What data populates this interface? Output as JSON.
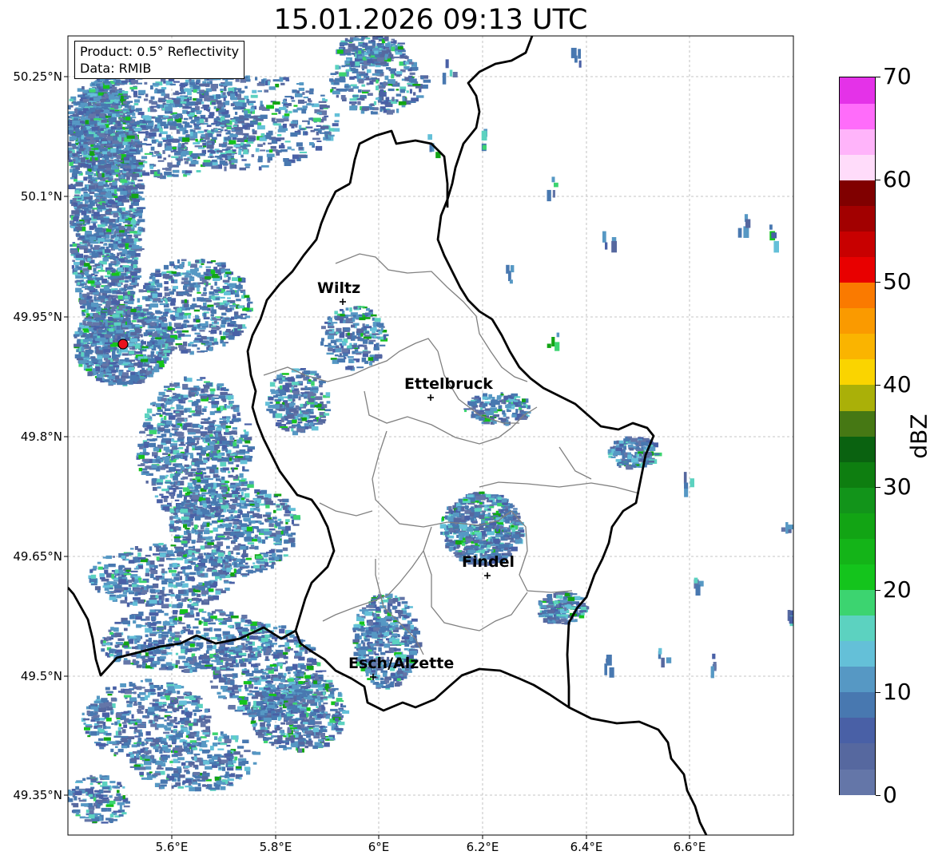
{
  "title": "15.01.2026 09:13 UTC",
  "info": {
    "product": "Product: 0.5° Reflectivity",
    "data": "Data: RMIB"
  },
  "lat_labels": [
    "50.25°N",
    "50.1°N",
    "49.95°N",
    "49.8°N",
    "49.65°N",
    "49.5°N",
    "49.35°N"
  ],
  "lon_labels": [
    "5.6°E",
    "5.8°E",
    "6°E",
    "6.2°E",
    "6.4°E",
    "6.6°E"
  ],
  "cities": [
    {
      "name": "Wiltz"
    },
    {
      "name": "Ettelbruck"
    },
    {
      "name": "Findel"
    },
    {
      "name": "Esch/Alzette"
    }
  ],
  "radar_site_color": "#e8121e",
  "colorbar": {
    "label": "dBZ",
    "ticks": [
      "0",
      "10",
      "20",
      "30",
      "40",
      "50",
      "60",
      "70"
    ],
    "colors": [
      "#6476a8",
      "#56689f",
      "#4960a6",
      "#4878b0",
      "#5698c4",
      "#64c0d8",
      "#5cd2c0",
      "#3cd470",
      "#14c41c",
      "#14b418",
      "#12a414",
      "#12941a",
      "#0e7e10",
      "#0a6210",
      "#467814",
      "#aab008",
      "#fad400",
      "#fab400",
      "#fa9a00",
      "#fa7a00",
      "#e80000",
      "#c80000",
      "#a20000",
      "#800000",
      "#ffdcfa",
      "#ffb4fa",
      "#ff6cfa",
      "#e432e8"
    ]
  }
}
